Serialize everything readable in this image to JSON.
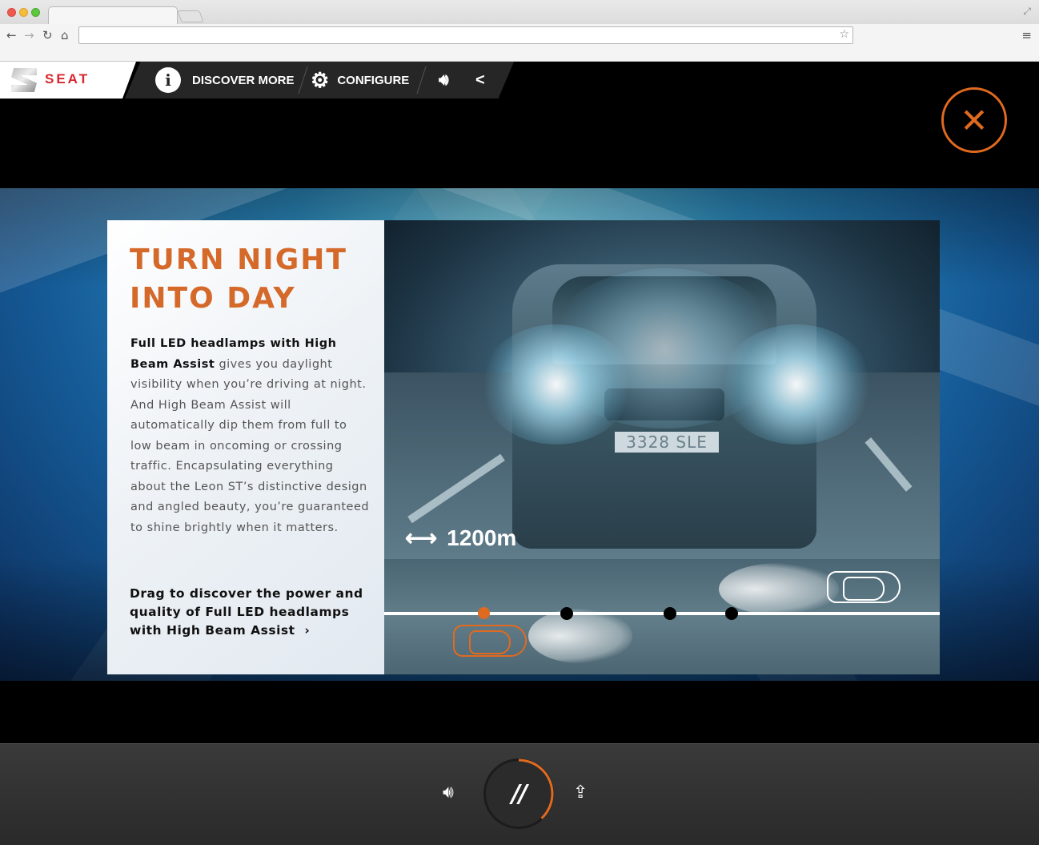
{
  "browser": {
    "tab_title": "",
    "address": "",
    "icons": {
      "back": "back-arrow-icon",
      "forward": "forward-arrow-icon",
      "reload": "reload-icon",
      "home": "home-icon",
      "bookmark": "star-icon",
      "menu": "hamburger-menu-icon"
    }
  },
  "header": {
    "brand": "SEAT",
    "nav": {
      "discover_label": "DISCOVER MORE",
      "configure_label": "CONFIGURE"
    },
    "icons": {
      "info": "info-icon",
      "gears": "gears-icon",
      "sound": "speaker-icon",
      "share": "share-icon",
      "close": "close-icon"
    }
  },
  "feature": {
    "title_line1": "TURN NIGHT",
    "title_line2": "INTO DAY",
    "body_bold": "Full LED headlamps with High Beam Assist",
    "body_rest": " gives you daylight visibility when you’re driving at night. And High Beam Assist will automatically dip them from full to low beam in oncoming or crossing traffic. Encapsulating everything about the Leon ST’s distinctive design and angled beauty, you’re guaranteed to shine brightly when it matters.",
    "drag_prompt": "Drag to discover the power and quality of Full LED headlamps with High Beam Assist",
    "drag_arrow": "›",
    "distance": "1200m",
    "plate": "3328 SLE",
    "slider": {
      "stops": 4,
      "active_index": 0
    }
  },
  "colors": {
    "accent": "#e06a1f",
    "brand_red": "#d8262f"
  },
  "player": {
    "pause_glyph": "//",
    "progress": 0.38,
    "icons": {
      "volume": "volume-icon",
      "pause": "pause-icon",
      "share": "share-arrow-icon"
    }
  }
}
